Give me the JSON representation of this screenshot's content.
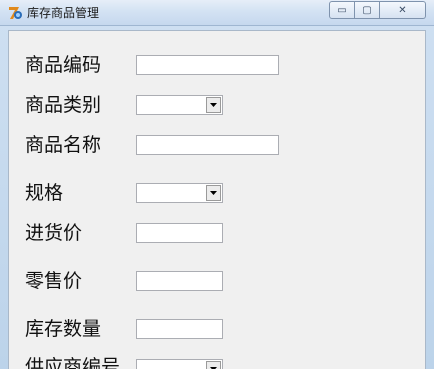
{
  "window": {
    "title": "库存商品管理",
    "minimize_glyph": "▭",
    "maximize_glyph": "▢",
    "close_glyph": "✕"
  },
  "form": {
    "fields": [
      {
        "label": "商品编码",
        "type": "text",
        "value": ""
      },
      {
        "label": "商品类别",
        "type": "combo",
        "value": ""
      },
      {
        "label": "商品名称",
        "type": "text",
        "value": ""
      },
      {
        "label": "规格",
        "type": "combo",
        "value": ""
      },
      {
        "label": "进货价",
        "type": "text",
        "value": ""
      },
      {
        "label": "零售价",
        "type": "text",
        "value": ""
      },
      {
        "label": "库存数量",
        "type": "text",
        "value": ""
      },
      {
        "label": "供应商编号",
        "type": "combo",
        "value": ""
      }
    ]
  },
  "colors": {
    "title_bar": "#d3e2f3",
    "client_bg": "#f0f0f0",
    "input_border": "#abadb3"
  },
  "icons": {
    "app": "app-icon",
    "minimize": "minimize-icon",
    "maximize": "maximize-icon",
    "close": "close-icon",
    "dropdown": "chevron-down-icon"
  }
}
